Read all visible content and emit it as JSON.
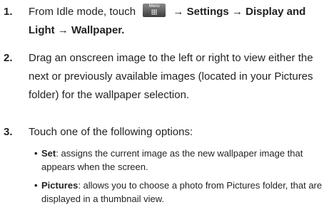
{
  "steps": [
    {
      "number": "1.",
      "prefix": "From Idle mode, touch",
      "menu_key_label": "Menu",
      "menu_key_icon": "menu-grid-icon",
      "arrow": "→",
      "path": [
        "Settings",
        "Display and Light",
        "Wallpaper."
      ]
    },
    {
      "number": "2.",
      "text": "Drag an onscreen image to the left or right to view either the next or previously available images (located in your Pictures folder) for the wallpaper selection."
    },
    {
      "number": "3.",
      "text": "Touch one of the following options:"
    }
  ],
  "options": [
    {
      "bullet": "•",
      "term": "Set",
      "description": ": assigns the current image as the new wallpaper image that appears when the screen."
    },
    {
      "bullet": "•",
      "term": "Pictures",
      "description": ": allows you to choose a photo from Pictures folder, that are displayed in a thumbnail view."
    }
  ]
}
